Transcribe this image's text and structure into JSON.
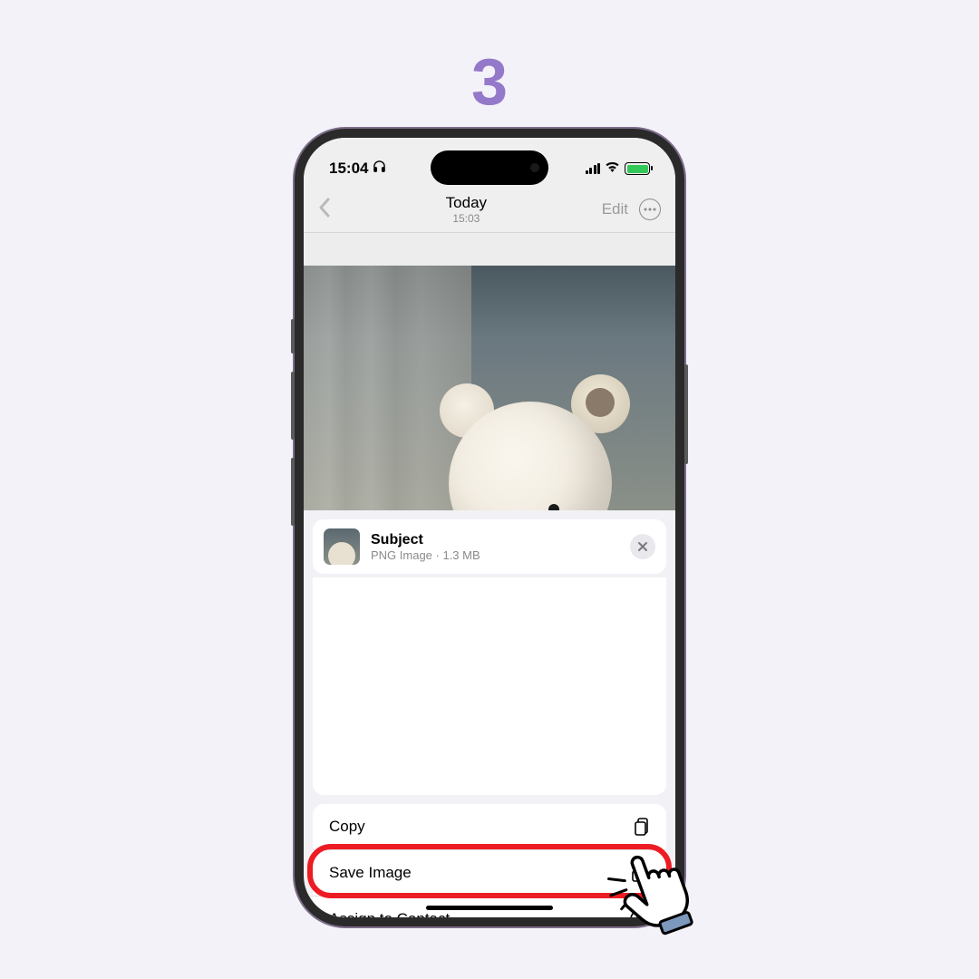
{
  "step_number": "3",
  "status": {
    "time": "15:04"
  },
  "nav": {
    "title": "Today",
    "subtitle": "15:03",
    "edit_label": "Edit"
  },
  "subject": {
    "title": "Subject",
    "meta": "PNG Image · 1.3 MB"
  },
  "actions": {
    "copy": "Copy",
    "save_image": "Save Image",
    "assign_to_contact": "Assign to Contact"
  },
  "colors": {
    "accent": "#9478c9",
    "highlight": "#ed1c24"
  }
}
